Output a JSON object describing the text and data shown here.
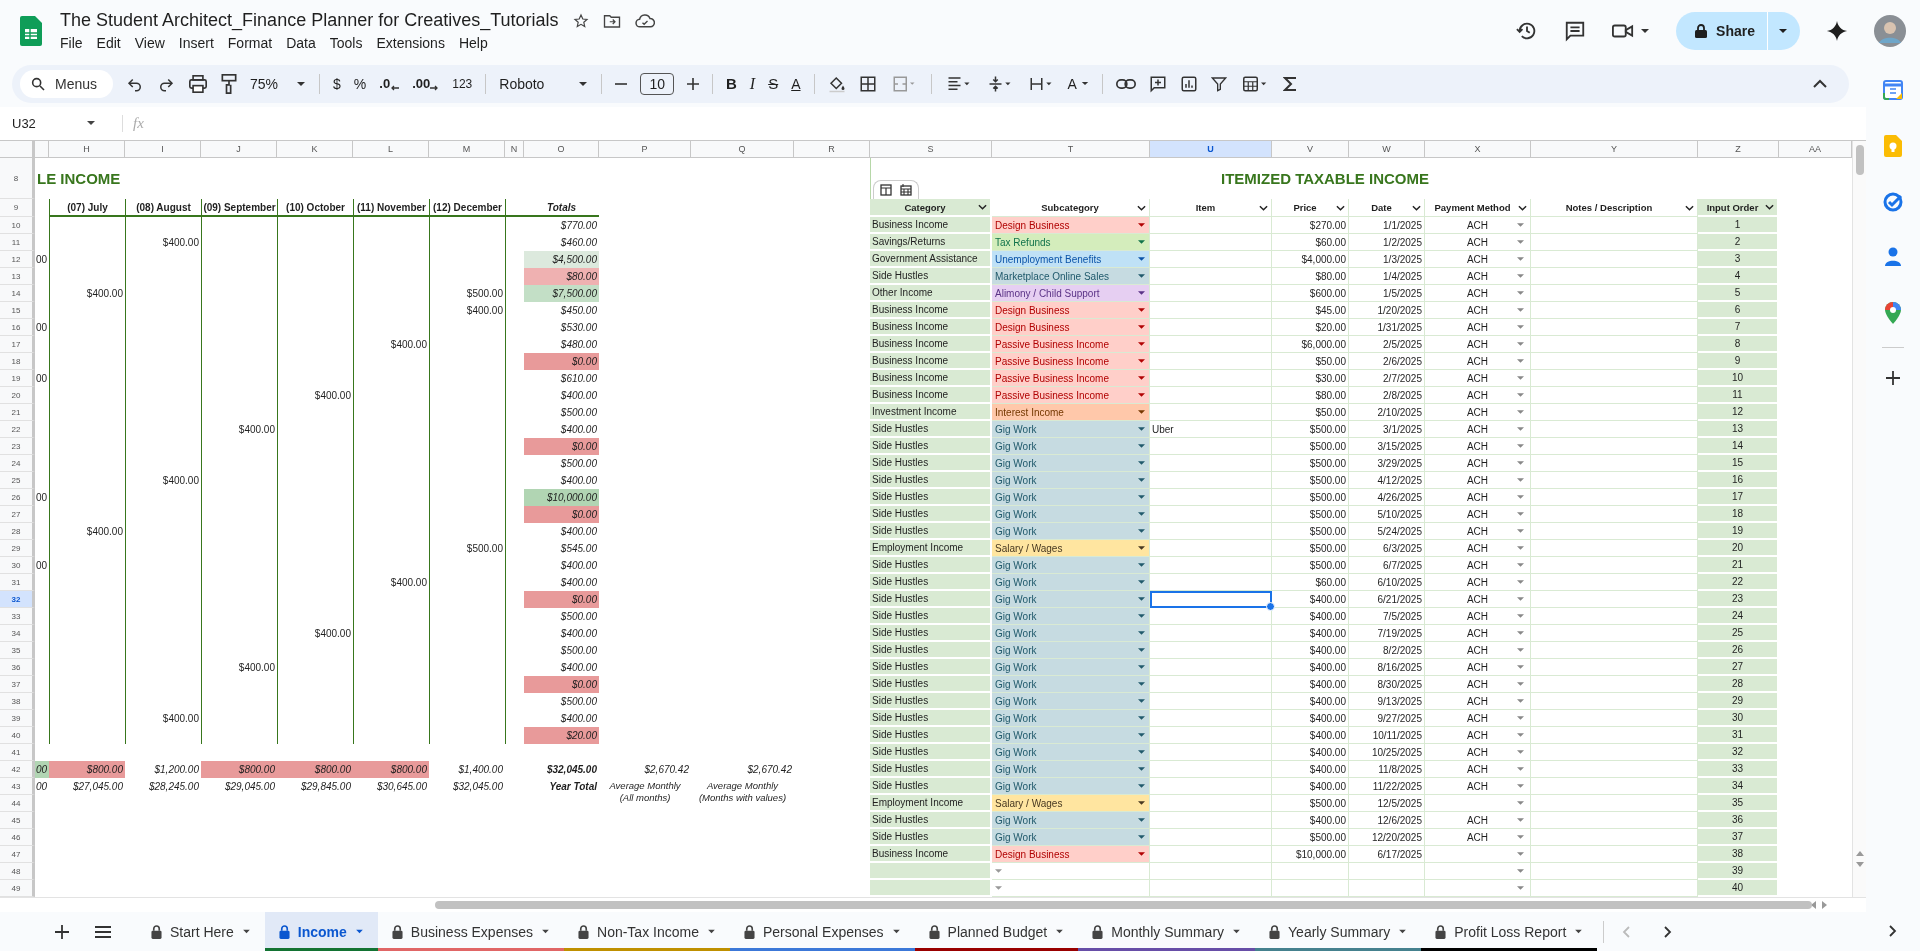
{
  "document": {
    "title": "The Student Architect_Finance Planner for Creatives_Tutorials"
  },
  "menu": [
    "File",
    "Edit",
    "View",
    "Insert",
    "Format",
    "Data",
    "Tools",
    "Extensions",
    "Help"
  ],
  "share_button": "Share",
  "toolbar": {
    "search": "Menus",
    "zoom": "75%",
    "currency": "$",
    "percent": "%",
    "decrease_decimals": ".0",
    "increase_decimals": ".00",
    "number_format": "123",
    "font": "Roboto",
    "font_size": "10",
    "bold": "B",
    "italic": "I",
    "strikethrough": "S",
    "text_color": "A",
    "text_rotation": "A"
  },
  "formula_bar": {
    "name_box": "U32",
    "fx": "fx"
  },
  "column_headers": [
    {
      "label": "H",
      "selected": false
    },
    {
      "label": "I",
      "selected": false
    },
    {
      "label": "J",
      "selected": false
    },
    {
      "label": "K",
      "selected": false
    },
    {
      "label": "L",
      "selected": false
    },
    {
      "label": "M",
      "selected": false
    },
    {
      "label": "N",
      "selected": false
    },
    {
      "label": "O",
      "selected": false
    },
    {
      "label": "P",
      "selected": false
    },
    {
      "label": "Q",
      "selected": false
    },
    {
      "label": "R",
      "selected": false
    },
    {
      "label": "S",
      "selected": false
    },
    {
      "label": "T",
      "selected": false
    },
    {
      "label": "U",
      "selected": true
    },
    {
      "label": "V",
      "selected": false
    },
    {
      "label": "W",
      "selected": false
    },
    {
      "label": "X",
      "selected": false
    },
    {
      "label": "Y",
      "selected": false
    },
    {
      "label": "Z",
      "selected": false
    },
    {
      "label": "AA",
      "selected": false
    }
  ],
  "row_headers": [
    {
      "label": "8",
      "selected": false
    },
    {
      "label": "9",
      "selected": false
    },
    {
      "label": "10",
      "selected": false
    },
    {
      "label": "11",
      "selected": false
    },
    {
      "label": "12",
      "selected": false
    },
    {
      "label": "13",
      "selected": false
    },
    {
      "label": "14",
      "selected": false
    },
    {
      "label": "15",
      "selected": false
    },
    {
      "label": "16",
      "selected": false
    },
    {
      "label": "17",
      "selected": false
    },
    {
      "label": "18",
      "selected": false
    },
    {
      "label": "19",
      "selected": false
    },
    {
      "label": "20",
      "selected": false
    },
    {
      "label": "21",
      "selected": false
    },
    {
      "label": "22",
      "selected": false
    },
    {
      "label": "23",
      "selected": false
    },
    {
      "label": "24",
      "selected": false
    },
    {
      "label": "25",
      "selected": false
    },
    {
      "label": "26",
      "selected": false
    },
    {
      "label": "27",
      "selected": false
    },
    {
      "label": "28",
      "selected": false
    },
    {
      "label": "29",
      "selected": false
    },
    {
      "label": "30",
      "selected": false
    },
    {
      "label": "31",
      "selected": false
    },
    {
      "label": "32",
      "selected": true
    },
    {
      "label": "33",
      "selected": false
    },
    {
      "label": "34",
      "selected": false
    },
    {
      "label": "35",
      "selected": false
    },
    {
      "label": "36",
      "selected": false
    },
    {
      "label": "37",
      "selected": false
    },
    {
      "label": "38",
      "selected": false
    },
    {
      "label": "39",
      "selected": false
    },
    {
      "label": "40",
      "selected": false
    },
    {
      "label": "41",
      "selected": false
    },
    {
      "label": "42",
      "selected": false
    },
    {
      "label": "43",
      "selected": false
    },
    {
      "label": "44",
      "selected": false
    },
    {
      "label": "45",
      "selected": false
    },
    {
      "label": "46",
      "selected": false
    },
    {
      "label": "47",
      "selected": false
    },
    {
      "label": "48",
      "selected": false
    },
    {
      "label": "49",
      "selected": false
    }
  ],
  "income_by_month": {
    "title": "LE INCOME",
    "headers": [
      "(07) July",
      "(08) August",
      "(09) September",
      "(10) October",
      "(11) November",
      "(12) December",
      "Totals"
    ],
    "rows": [
      {
        "total": "$770.00"
      },
      {
        "august": "$400.00",
        "total": "$460.00"
      },
      {
        "col_g": "00",
        "total": "$4,500.00",
        "color": "#dce9dd"
      },
      {
        "total": "$80.00",
        "color": "#efb1b1"
      },
      {
        "july": "$400.00",
        "december": "$500.00",
        "total": "$7,500.00",
        "color": "#c3dfc6"
      },
      {
        "december": "$400.00",
        "total": "$450.00"
      },
      {
        "col_g": "00",
        "total": "$530.00"
      },
      {
        "november": "$400.00",
        "total": "$480.00"
      },
      {
        "total": "$0.00",
        "color": "#e89a9a"
      },
      {
        "col_g": "00",
        "total": "$610.00"
      },
      {
        "october": "$400.00",
        "total": "$400.00"
      },
      {
        "total": "$500.00"
      },
      {
        "september": "$400.00",
        "total": "$400.00"
      },
      {
        "total": "$0.00",
        "color": "#e89a9a"
      },
      {
        "total": "$500.00"
      },
      {
        "august": "$400.00",
        "total": "$400.00"
      },
      {
        "col_g": "00",
        "total": "$10,000.00",
        "color": "#b1d5b3"
      },
      {
        "total": "$0.00",
        "color": "#e89a9a"
      },
      {
        "july": "$400.00",
        "total": "$400.00"
      },
      {
        "december": "$500.00",
        "total": "$545.00"
      },
      {
        "col_g": "00",
        "total": "$400.00"
      },
      {
        "november": "$400.00",
        "total": "$400.00"
      },
      {
        "total": "$0.00",
        "color": "#e89a9a"
      },
      {
        "total": "$500.00"
      },
      {
        "october": "$400.00",
        "total": "$400.00"
      },
      {
        "total": "$500.00"
      },
      {
        "september": "$400.00",
        "total": "$400.00"
      },
      {
        "total": "$0.00",
        "color": "#e89a9a"
      },
      {
        "total": "$500.00"
      },
      {
        "august": "$400.00",
        "total": "$400.00"
      },
      {
        "total": "$20.00",
        "color": "#e89a9a"
      }
    ],
    "sum_row": [
      {
        "value": "00",
        "color": "#b1d5b3"
      },
      {
        "value": "$800.00",
        "color": "#e89a9a"
      },
      {
        "value": "$1,200.00"
      },
      {
        "value": "$800.00",
        "color": "#e89a9a"
      },
      {
        "value": "$800.00",
        "color": "#e89a9a"
      },
      {
        "value": "$800.00",
        "color": "#e89a9a"
      },
      {
        "value": "$1,400.00"
      },
      {
        "value": "$32,045.00"
      },
      {
        "value": "$2,670.42"
      },
      {
        "value": "$2,670.42"
      }
    ],
    "cumulative_row": [
      "00",
      "$27,045.00",
      "$28,245.00",
      "$29,045.00",
      "$29,845.00",
      "$30,645.00",
      "$32,045.00",
      "Year Total",
      "Average Monthly (All months)",
      "Average Monthly (Months with values)"
    ]
  },
  "itemized": {
    "title": "ITEMIZED TAXABLE INCOME",
    "columns": [
      "Category",
      "Subcategory",
      "Item",
      "Price",
      "Date",
      "Payment Method",
      "Notes / Description",
      "Input Order"
    ],
    "rows": [
      {
        "category": "Business Income",
        "subcategory": "Design Business",
        "color": "#ffcfc9",
        "price": "$270.00",
        "date": "1/1/2025",
        "payment": "ACH",
        "order": "1",
        "selected": false
      },
      {
        "category": "Savings/Returns",
        "subcategory": "Tax Refunds",
        "color": "#d4edbc",
        "price": "$60.00",
        "date": "1/2/2025",
        "payment": "ACH",
        "order": "2",
        "selected": false
      },
      {
        "category": "Government Assistance",
        "subcategory": "Unemployment Benefits",
        "color": "#bfe1f6",
        "price": "$4,000.00",
        "date": "1/3/2025",
        "payment": "ACH",
        "order": "3",
        "selected": false
      },
      {
        "category": "Side Hustles",
        "subcategory": "Marketplace Online Sales",
        "color": "#c6dbe1",
        "price": "$80.00",
        "date": "1/4/2025",
        "payment": "ACH",
        "order": "4",
        "selected": false
      },
      {
        "category": "Other Income",
        "subcategory": "Alimony / Child Support",
        "color": "#e6cff2",
        "price": "$600.00",
        "date": "1/5/2025",
        "payment": "ACH",
        "order": "5",
        "selected": false
      },
      {
        "category": "Business Income",
        "subcategory": "Design Business",
        "color": "#ffcfc9",
        "price": "$45.00",
        "date": "1/20/2025",
        "payment": "ACH",
        "order": "6",
        "selected": false
      },
      {
        "category": "Business Income",
        "subcategory": "Design Business",
        "color": "#ffcfc9",
        "price": "$20.00",
        "date": "1/31/2025",
        "payment": "ACH",
        "order": "7",
        "selected": false
      },
      {
        "category": "Business Income",
        "subcategory": "Passive Business Income",
        "color": "#ffcfc9",
        "price": "$6,000.00",
        "date": "2/5/2025",
        "payment": "ACH",
        "order": "8",
        "selected": false
      },
      {
        "category": "Business Income",
        "subcategory": "Passive Business Income",
        "color": "#ffcfc9",
        "price": "$50.00",
        "date": "2/6/2025",
        "payment": "ACH",
        "order": "9",
        "selected": false
      },
      {
        "category": "Business Income",
        "subcategory": "Passive Business Income",
        "color": "#ffcfc9",
        "price": "$30.00",
        "date": "2/7/2025",
        "payment": "ACH",
        "order": "10",
        "selected": false
      },
      {
        "category": "Business Income",
        "subcategory": "Passive Business Income",
        "color": "#ffcfc9",
        "price": "$80.00",
        "date": "2/8/2025",
        "payment": "ACH",
        "order": "11",
        "selected": false
      },
      {
        "category": "Investment Income",
        "subcategory": "Interest Income",
        "color": "#ffc8aa",
        "price": "$50.00",
        "date": "2/10/2025",
        "payment": "ACH",
        "order": "12",
        "selected": false
      },
      {
        "category": "Side Hustles",
        "subcategory": "Gig Work",
        "color": "#c6dbe1",
        "item": "Uber",
        "price": "$500.00",
        "date": "3/1/2025",
        "payment": "ACH",
        "order": "13",
        "selected": false
      },
      {
        "category": "Side Hustles",
        "subcategory": "Gig Work",
        "color": "#c6dbe1",
        "price": "$500.00",
        "date": "3/15/2025",
        "payment": "ACH",
        "order": "14",
        "selected": false
      },
      {
        "category": "Side Hustles",
        "subcategory": "Gig Work",
        "color": "#c6dbe1",
        "price": "$500.00",
        "date": "3/29/2025",
        "payment": "ACH",
        "order": "15",
        "selected": false
      },
      {
        "category": "Side Hustles",
        "subcategory": "Gig Work",
        "color": "#c6dbe1",
        "price": "$500.00",
        "date": "4/12/2025",
        "payment": "ACH",
        "order": "16",
        "selected": false
      },
      {
        "category": "Side Hustles",
        "subcategory": "Gig Work",
        "color": "#c6dbe1",
        "price": "$500.00",
        "date": "4/26/2025",
        "payment": "ACH",
        "order": "17",
        "selected": false
      },
      {
        "category": "Side Hustles",
        "subcategory": "Gig Work",
        "color": "#c6dbe1",
        "price": "$500.00",
        "date": "5/10/2025",
        "payment": "ACH",
        "order": "18",
        "selected": false
      },
      {
        "category": "Side Hustles",
        "subcategory": "Gig Work",
        "color": "#c6dbe1",
        "price": "$500.00",
        "date": "5/24/2025",
        "payment": "ACH",
        "order": "19",
        "selected": false
      },
      {
        "category": "Employment Income",
        "subcategory": "Salary / Wages",
        "color": "#ffe5a0",
        "price": "$500.00",
        "date": "6/3/2025",
        "payment": "ACH",
        "order": "20",
        "selected": false
      },
      {
        "category": "Side Hustles",
        "subcategory": "Gig Work",
        "color": "#c6dbe1",
        "price": "$500.00",
        "date": "6/7/2025",
        "payment": "ACH",
        "order": "21",
        "selected": false
      },
      {
        "category": "Side Hustles",
        "subcategory": "Gig Work",
        "color": "#c6dbe1",
        "price": "$60.00",
        "date": "6/10/2025",
        "payment": "ACH",
        "order": "22",
        "selected": false
      },
      {
        "category": "Side Hustles",
        "subcategory": "Gig Work",
        "color": "#c6dbe1",
        "price": "$400.00",
        "date": "6/21/2025",
        "payment": "ACH",
        "order": "23",
        "selected": true
      },
      {
        "category": "Side Hustles",
        "subcategory": "Gig Work",
        "color": "#c6dbe1",
        "price": "$400.00",
        "date": "7/5/2025",
        "payment": "ACH",
        "order": "24",
        "selected": false
      },
      {
        "category": "Side Hustles",
        "subcategory": "Gig Work",
        "color": "#c6dbe1",
        "price": "$400.00",
        "date": "7/19/2025",
        "payment": "ACH",
        "order": "25",
        "selected": false
      },
      {
        "category": "Side Hustles",
        "subcategory": "Gig Work",
        "color": "#c6dbe1",
        "price": "$400.00",
        "date": "8/2/2025",
        "payment": "ACH",
        "order": "26",
        "selected": false
      },
      {
        "category": "Side Hustles",
        "subcategory": "Gig Work",
        "color": "#c6dbe1",
        "price": "$400.00",
        "date": "8/16/2025",
        "payment": "ACH",
        "order": "27",
        "selected": false
      },
      {
        "category": "Side Hustles",
        "subcategory": "Gig Work",
        "color": "#c6dbe1",
        "price": "$400.00",
        "date": "8/30/2025",
        "payment": "ACH",
        "order": "28",
        "selected": false
      },
      {
        "category": "Side Hustles",
        "subcategory": "Gig Work",
        "color": "#c6dbe1",
        "price": "$400.00",
        "date": "9/13/2025",
        "payment": "ACH",
        "order": "29",
        "selected": false
      },
      {
        "category": "Side Hustles",
        "subcategory": "Gig Work",
        "color": "#c6dbe1",
        "price": "$400.00",
        "date": "9/27/2025",
        "payment": "ACH",
        "order": "30",
        "selected": false
      },
      {
        "category": "Side Hustles",
        "subcategory": "Gig Work",
        "color": "#c6dbe1",
        "price": "$400.00",
        "date": "10/11/2025",
        "payment": "ACH",
        "order": "31",
        "selected": false
      },
      {
        "category": "Side Hustles",
        "subcategory": "Gig Work",
        "color": "#c6dbe1",
        "price": "$400.00",
        "date": "10/25/2025",
        "payment": "ACH",
        "order": "32",
        "selected": false
      },
      {
        "category": "Side Hustles",
        "subcategory": "Gig Work",
        "color": "#c6dbe1",
        "price": "$400.00",
        "date": "11/8/2025",
        "payment": "ACH",
        "order": "33",
        "selected": false
      },
      {
        "category": "Side Hustles",
        "subcategory": "Gig Work",
        "color": "#c6dbe1",
        "price": "$400.00",
        "date": "11/22/2025",
        "payment": "ACH",
        "order": "34",
        "selected": false
      },
      {
        "category": "Employment Income",
        "subcategory": "Salary / Wages",
        "color": "#ffe5a0",
        "price": "$500.00",
        "date": "12/5/2025",
        "order": "35",
        "selected": false
      },
      {
        "category": "Side Hustles",
        "subcategory": "Gig Work",
        "color": "#c6dbe1",
        "price": "$400.00",
        "date": "12/6/2025",
        "payment": "ACH",
        "order": "36",
        "selected": false
      },
      {
        "category": "Side Hustles",
        "subcategory": "Gig Work",
        "color": "#c6dbe1",
        "price": "$500.00",
        "date": "12/20/2025",
        "payment": "ACH",
        "order": "37",
        "selected": false
      },
      {
        "category": "Business Income",
        "subcategory": "Design Business",
        "color": "#ffcfc9",
        "price": "$10,000.00",
        "date": "6/17/2025",
        "order": "38",
        "selected": false
      },
      {
        "order": "39",
        "selected": false
      },
      {
        "order": "40",
        "selected": false
      }
    ]
  },
  "sheet_tabs": [
    {
      "label": "Start Here",
      "selected": false
    },
    {
      "label": "Income",
      "selected": true,
      "color": "#137333"
    },
    {
      "label": "Business Expenses",
      "selected": false,
      "color": "#e06666"
    },
    {
      "label": "Non-Tax Income",
      "selected": false,
      "color": "#bf9000"
    },
    {
      "label": "Personal Expenses",
      "selected": false,
      "color": "#3c78d8"
    },
    {
      "label": "Planned Budget",
      "selected": false,
      "color": "#990000"
    },
    {
      "label": "Monthly Summary",
      "selected": false,
      "color": "#674ea7"
    },
    {
      "label": "Yearly Summary",
      "selected": false,
      "color": "#45818e"
    },
    {
      "label": "Profit Loss Report",
      "selected": false,
      "color": "#000000"
    }
  ]
}
